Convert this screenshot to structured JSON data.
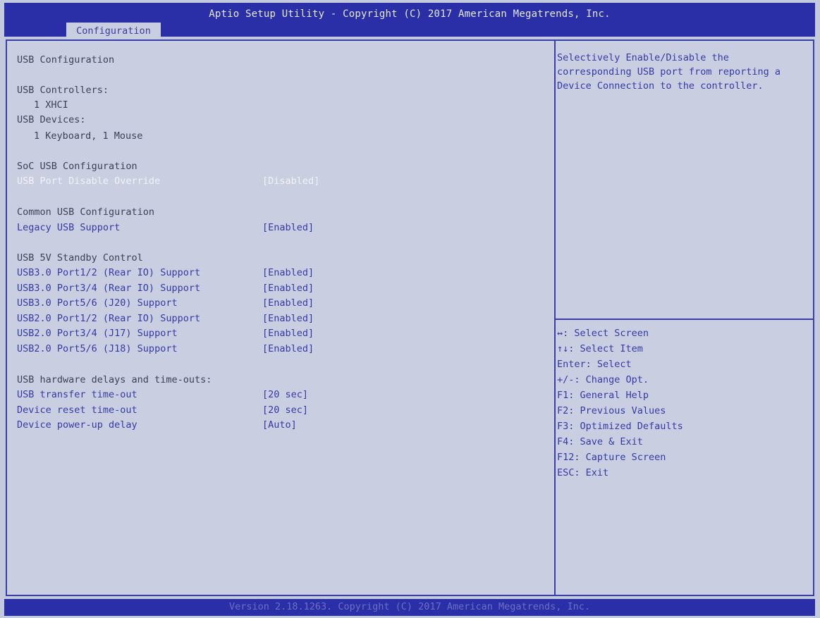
{
  "header": {
    "title": "Aptio Setup Utility - Copyright (C) 2017 American Megatrends, Inc.",
    "tab": "Configuration"
  },
  "main": {
    "section_title": "USB Configuration",
    "controllers_label": "USB Controllers:",
    "controllers_value": "1 XHCI",
    "devices_label": "USB Devices:",
    "devices_value": "1 Keyboard, 1 Mouse",
    "soc_heading": "SoC USB Configuration",
    "port_override": {
      "label": "USB Port Disable Override",
      "value": "[Disabled]"
    },
    "common_heading": "Common USB Configuration",
    "legacy": {
      "label": "Legacy USB Support",
      "value": "[Enabled]"
    },
    "standby_heading": "USB 5V Standby Control",
    "ports": [
      {
        "label": "USB3.0 Port1/2 (Rear IO) Support",
        "value": "[Enabled]"
      },
      {
        "label": "USB3.0 Port3/4 (Rear IO) Support",
        "value": "[Enabled]"
      },
      {
        "label": "USB3.0 Port5/6 (J20) Support",
        "value": "[Enabled]"
      },
      {
        "label": "USB2.0 Port1/2 (Rear IO) Support",
        "value": "[Enabled]"
      },
      {
        "label": "USB2.0 Port3/4 (J17) Support",
        "value": "[Enabled]"
      },
      {
        "label": "USB2.0 Port5/6 (J18) Support",
        "value": "[Enabled]"
      }
    ],
    "delays_heading": "USB hardware delays and time-outs:",
    "delays": [
      {
        "label": "USB transfer time-out",
        "value": "[20 sec]"
      },
      {
        "label": "Device reset time-out",
        "value": "[20 sec]"
      },
      {
        "label": "Device power-up delay",
        "value": "[Auto]"
      }
    ]
  },
  "help": {
    "lines": [
      "Selectively Enable/Disable the",
      "corresponding USB port from reporting a",
      "Device Connection to the controller."
    ]
  },
  "keys": [
    "↔: Select Screen",
    "↑↓: Select Item",
    "Enter: Select",
    "+/-: Change Opt.",
    "F1: General Help",
    "F2: Previous Values",
    "F3: Optimized Defaults",
    "F4: Save & Exit",
    "F12: Capture Screen",
    "ESC: Exit"
  ],
  "footer": {
    "text": "Version 2.18.1263. Copyright (C) 2017 American Megatrends, Inc."
  },
  "colors": {
    "bar_blue": "#2a2fa8",
    "background": "#c9cfe0",
    "item_text": "#3539a6",
    "plain_text": "#3d3f58",
    "selected_text": "#f2f3fa"
  }
}
